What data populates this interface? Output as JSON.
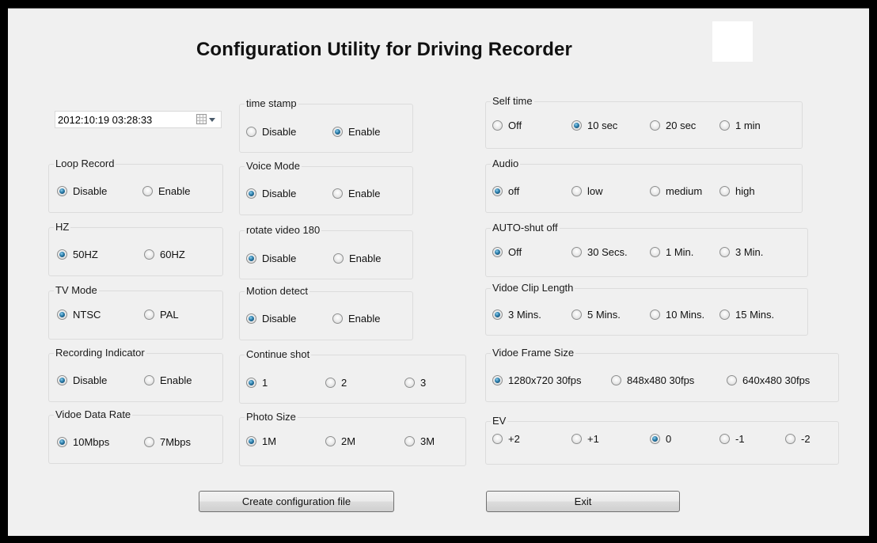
{
  "window": {
    "title": "Configuration Utility for Driving Recorder"
  },
  "datetime": {
    "value": "2012:10:19 03:28:33",
    "icon": "calendar-icon"
  },
  "groups": {
    "loop_record": {
      "label": "Loop Record",
      "options": [
        "Disable",
        "Enable"
      ],
      "selected": "Disable"
    },
    "hz": {
      "label": "HZ",
      "options": [
        "50HZ",
        "60HZ"
      ],
      "selected": "50HZ"
    },
    "tv_mode": {
      "label": "TV Mode",
      "options": [
        "NTSC",
        "PAL"
      ],
      "selected": "NTSC"
    },
    "recording_indicator": {
      "label": "Recording Indicator",
      "options": [
        "Disable",
        "Enable"
      ],
      "selected": "Disable"
    },
    "video_data_rate": {
      "label": "Vidoe Data Rate",
      "options": [
        "10Mbps",
        "7Mbps"
      ],
      "selected": "10Mbps"
    },
    "time_stamp": {
      "label": "time stamp",
      "options": [
        "Disable",
        "Enable"
      ],
      "selected": "Enable"
    },
    "voice_mode": {
      "label": "Voice Mode",
      "options": [
        "Disable",
        "Enable"
      ],
      "selected": "Disable"
    },
    "rotate_video": {
      "label": "rotate video 180",
      "options": [
        "Disable",
        "Enable"
      ],
      "selected": "Disable"
    },
    "motion_detect": {
      "label": "Motion detect",
      "options": [
        "Disable",
        "Enable"
      ],
      "selected": "Disable"
    },
    "continue_shot": {
      "label": "Continue shot",
      "options": [
        "1",
        "2",
        "3"
      ],
      "selected": "1"
    },
    "photo_size": {
      "label": "Photo Size",
      "options": [
        "1M",
        "2M",
        "3M"
      ],
      "selected": "1M"
    },
    "self_time": {
      "label": "Self time",
      "options": [
        "Off",
        "10 sec",
        "20 sec",
        "1 min"
      ],
      "selected": "10 sec"
    },
    "audio": {
      "label": "Audio",
      "options": [
        "off",
        "low",
        "medium",
        "high"
      ],
      "selected": "off"
    },
    "auto_shut_off": {
      "label": "AUTO-shut off",
      "options": [
        "Off",
        "30 Secs.",
        "1 Min.",
        "3 Min."
      ],
      "selected": "Off"
    },
    "video_clip_length": {
      "label": "Vidoe Clip Length",
      "options": [
        "3 Mins.",
        "5 Mins.",
        "10 Mins.",
        "15 Mins."
      ],
      "selected": "3 Mins."
    },
    "video_frame_size": {
      "label": "Vidoe Frame Size",
      "options": [
        "1280x720 30fps",
        "848x480 30fps",
        "640x480 30fps"
      ],
      "selected": "1280x720 30fps"
    },
    "ev": {
      "label": "EV",
      "options": [
        "+2",
        "+1",
        "0",
        "-1",
        "-2"
      ],
      "selected": "0"
    }
  },
  "buttons": {
    "create": "Create configuration file",
    "exit": "Exit"
  }
}
